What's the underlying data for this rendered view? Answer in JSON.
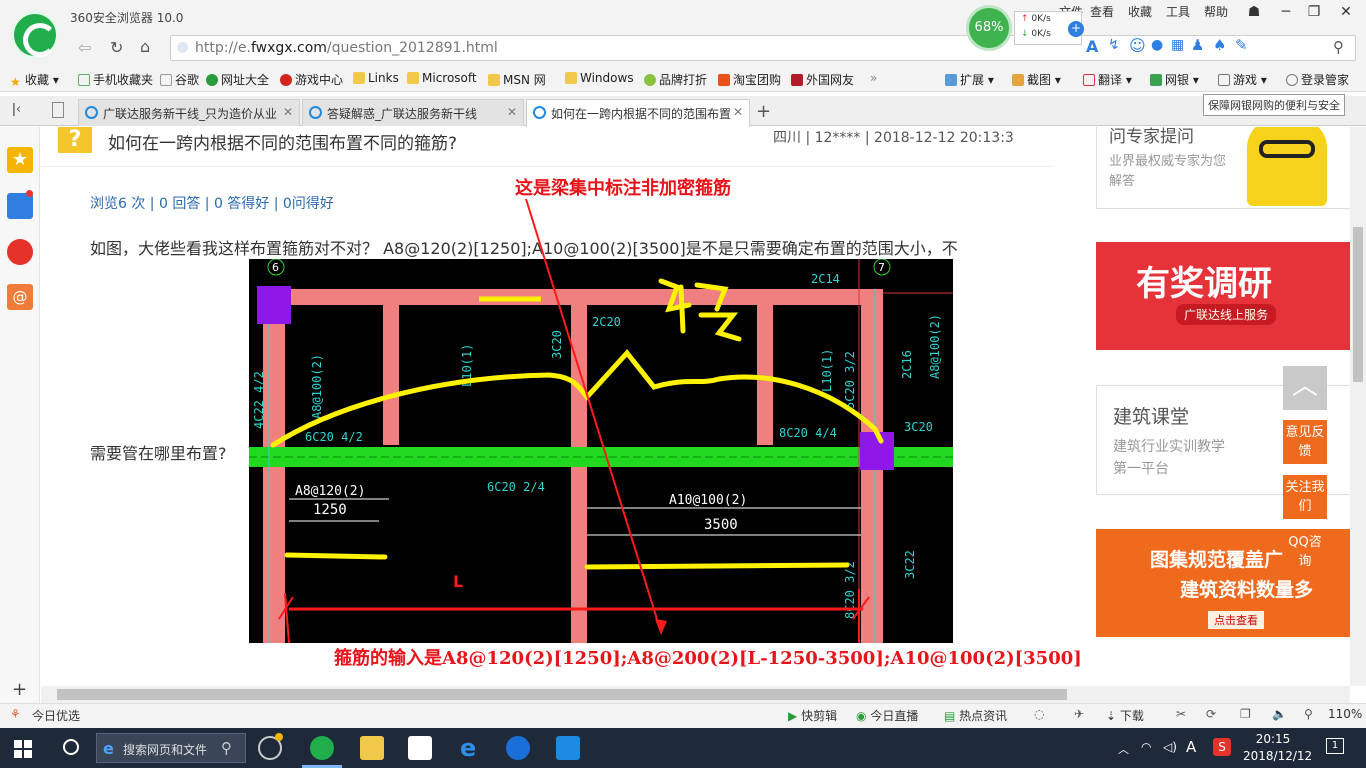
{
  "browser": {
    "app_title": "360安全浏览器 10.0",
    "menu": [
      "文件",
      "查看",
      "收藏",
      "工具",
      "帮助"
    ],
    "url_prefix": "http://e.",
    "url_domain": "fwxgx.com",
    "url_path": "/question_2012891.html",
    "speed": {
      "percent": "68%",
      "up": "0K/s",
      "down": "0K/s"
    },
    "bookmarks": [
      "收藏",
      "手机收藏夹",
      "谷歌",
      "网址大全",
      "游戏中心",
      "Links",
      "Microsoft",
      "MSN 网",
      "Windows",
      "品牌打折",
      "淘宝团购",
      "外国网友"
    ],
    "tools": [
      "扩展",
      "截图",
      "翻译",
      "网银",
      "游戏",
      "登录管家"
    ],
    "tooltip": "保障网银网购的便利与安全",
    "tabs": [
      {
        "label": "广联达服务新干线_只为造价从业"
      },
      {
        "label": "答疑解惑_广联达服务新干线"
      },
      {
        "label": "如何在一跨内根据不同的范围布置"
      }
    ]
  },
  "question": {
    "mark": "?",
    "title": "如何在一跨内根据不同的范围布置不同的箍筋?",
    "meta": "四川 | 12**** | 2018-12-12 20:13:3",
    "stats": "浏览6 次 | 0 回答 | 0 答得好 | 0问得好",
    "body_line1": "如图，大佬些看我这样布置箍筋对不对？ A8@120(2)[1250];A10@100(2)[3500]是不是只需要确定布置的范围大小，不",
    "body_line2": "需要管在哪里布置?"
  },
  "cad": {
    "axis_left": "6",
    "axis_right": "7",
    "labels": [
      "2C14",
      "2C20",
      "3C20",
      "L10(1)",
      "L10(1)",
      "8C20 4/4",
      "6C20 4/2",
      "2C16",
      "A8@100(2)",
      "5C20 3/2",
      "4C22 4/2",
      "A8@100(2)",
      "6C20 2/4",
      "3C20",
      "3C22",
      "8C20 3/2"
    ],
    "dim1_label": "A8@120(2)",
    "dim1_value": "1250",
    "dim2_label": "A10@100(2)",
    "dim2_value": "3500",
    "span_label": "L",
    "handwriting": "一跨"
  },
  "annotations": {
    "top": "这是梁集中标注非加密箍筋",
    "bottom": "箍筋的输入是A8@120(2)[1250];A8@200(2)[L-1250-3500];A10@100(2)[3500]"
  },
  "sidebar_ads": {
    "card1_title": "问专家提问",
    "card1_sub": "业界最权威专家为您解答",
    "card2_title": "有奖调研",
    "card2_sub": "广联达线上服务",
    "card3_title": "建筑课堂",
    "card3_sub": "建筑行业实训教学第一平台",
    "card4_title": "图集规范覆盖广",
    "card4_sub": "建筑资料数量多",
    "card4_btn": "点击查看",
    "float_feedback": "意见反馈",
    "float_follow": "关注我们",
    "float_qq": "QQ咨询"
  },
  "status": {
    "left": "今日优选",
    "items": [
      "快剪辑",
      "今日直播",
      "热点资讯",
      "下载"
    ],
    "zoom": "110%"
  },
  "taskbar": {
    "search_placeholder": "搜索网页和文件",
    "time": "20:15",
    "date": "2018/12/12",
    "ime": "A",
    "notif_count": "1"
  }
}
